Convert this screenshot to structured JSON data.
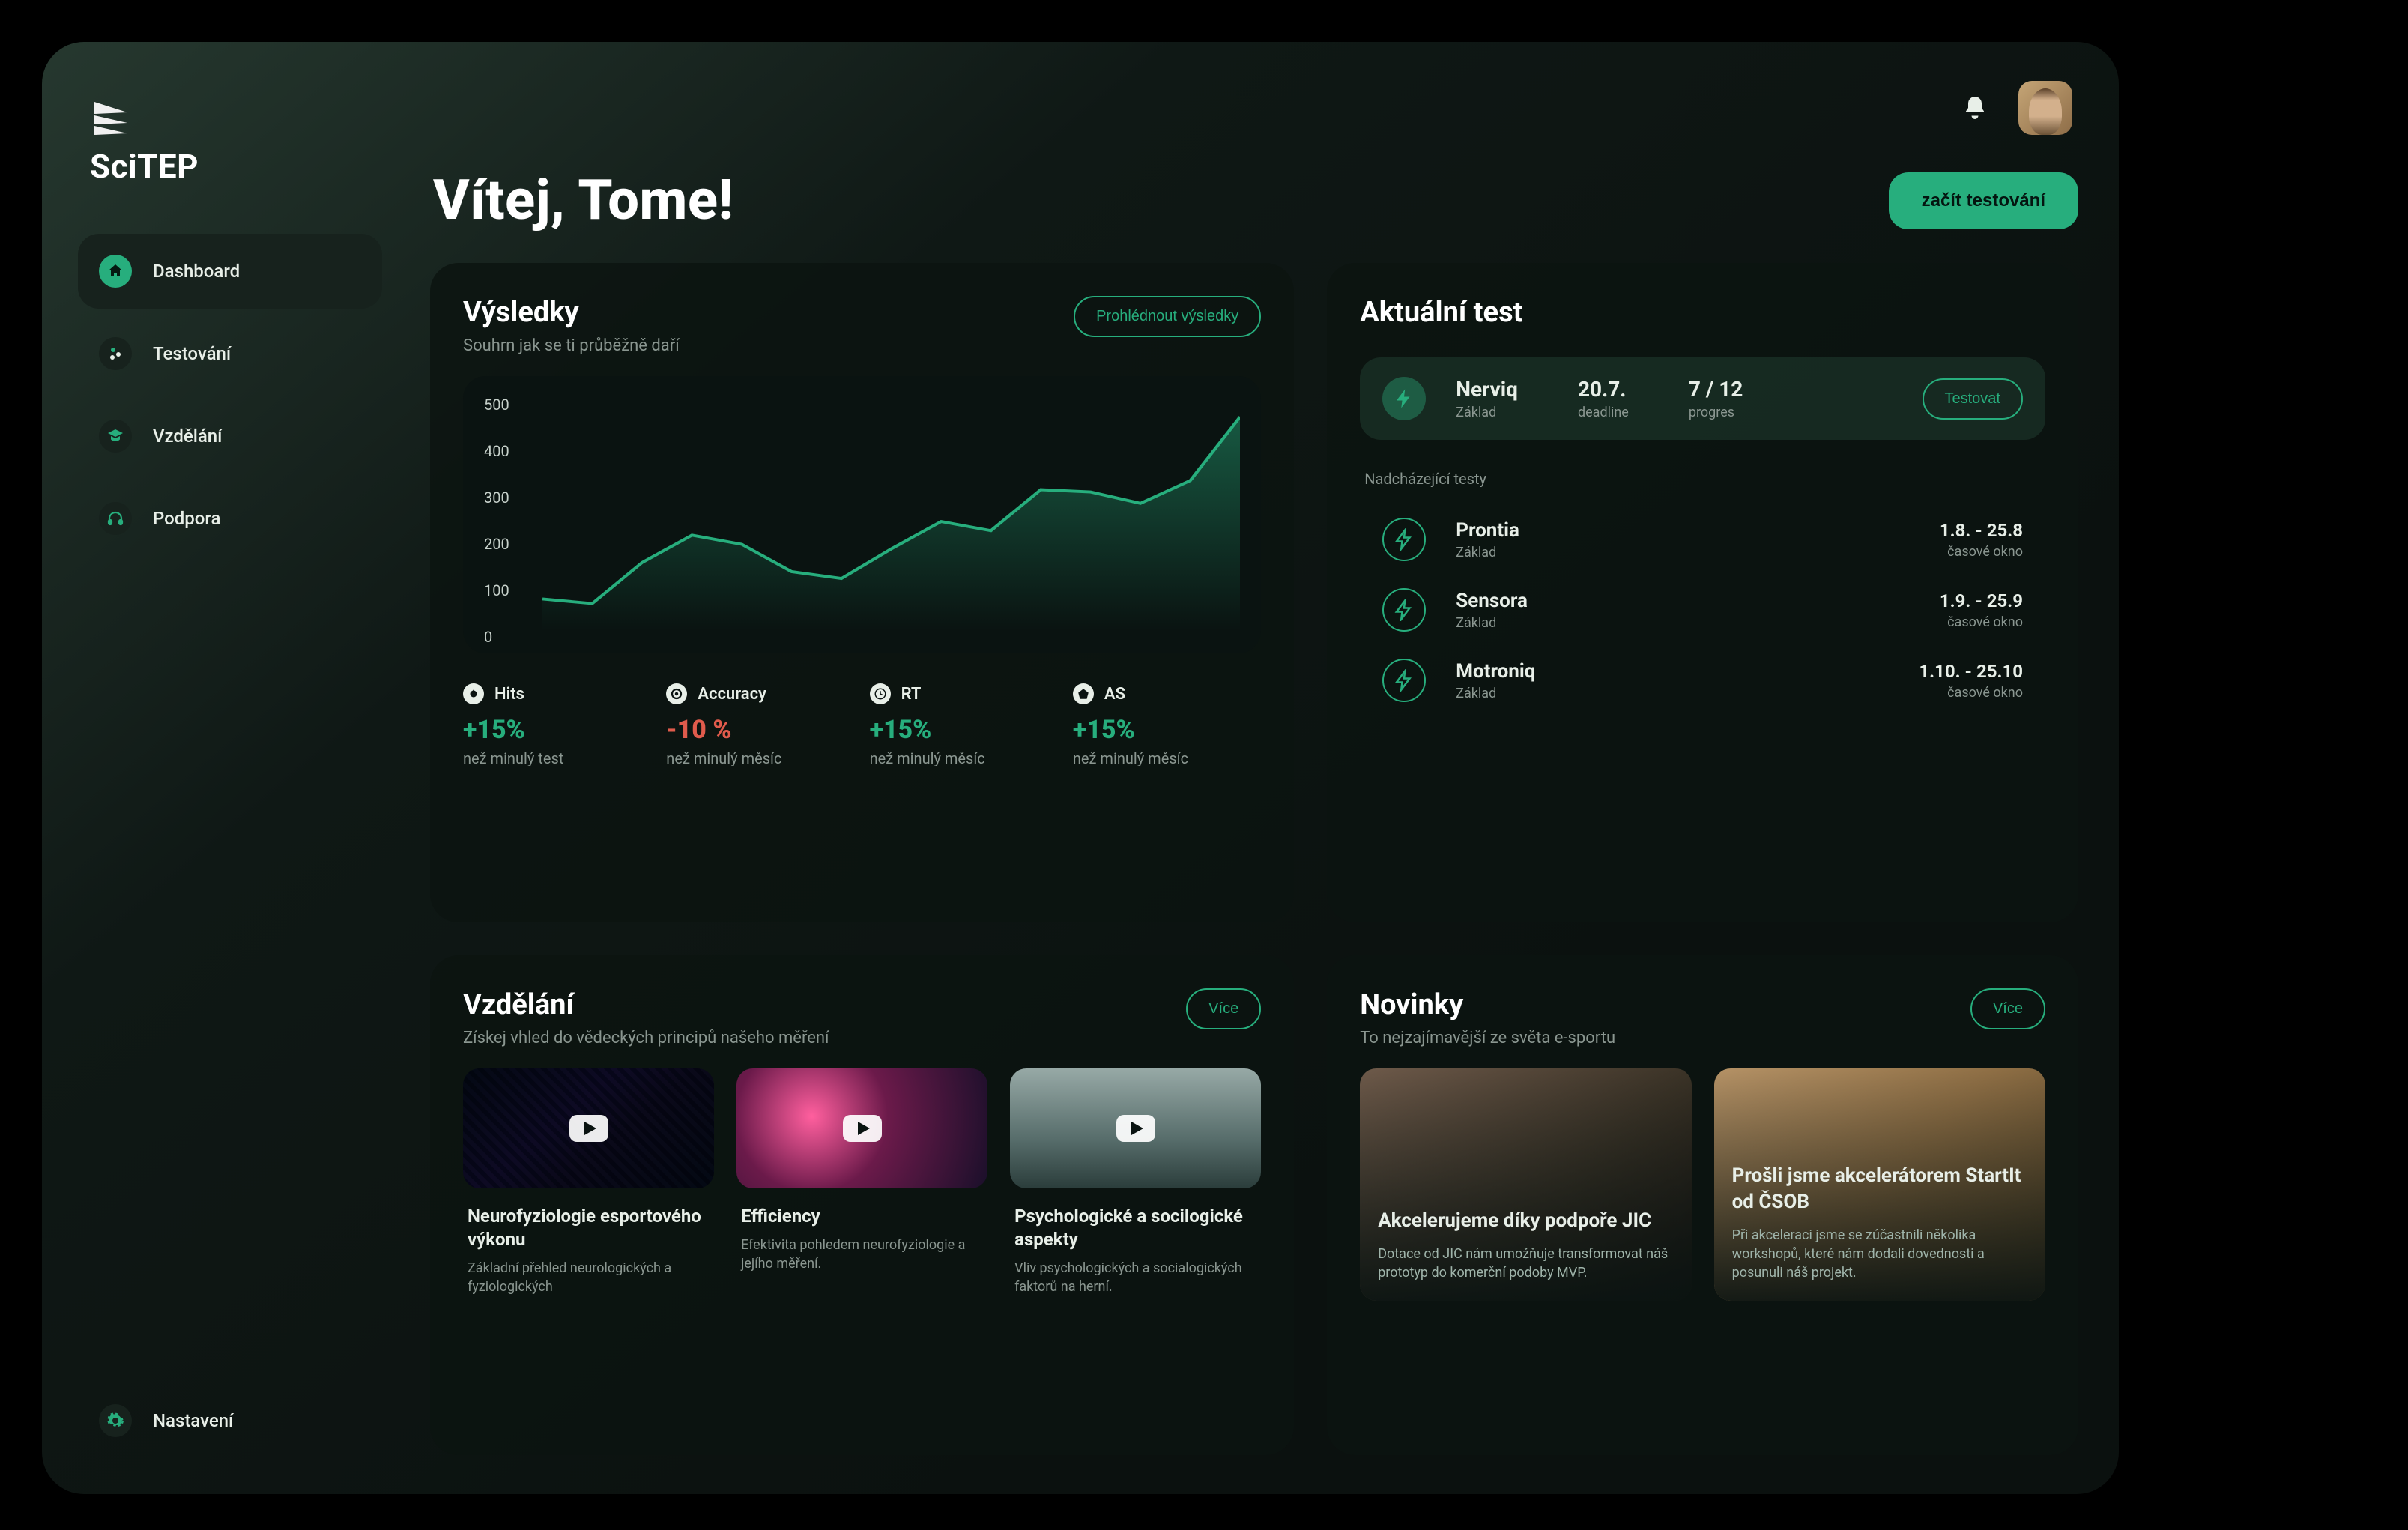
{
  "app": {
    "name": "SciTEP"
  },
  "sidebar": {
    "items": [
      {
        "label": "Dashboard"
      },
      {
        "label": "Testování"
      },
      {
        "label": "Vzdělání"
      },
      {
        "label": "Podpora"
      }
    ],
    "settings_label": "Nastavení"
  },
  "hero": {
    "greeting": "Vítej, Tome!",
    "cta": "začít testování"
  },
  "results": {
    "title": "Výsledky",
    "subtitle": "Souhrn jak se ti průběžně daří",
    "view_btn": "Prohlédnout výsledky",
    "metrics": [
      {
        "name": "Hits",
        "delta": "+15%",
        "sub": "než minulý test",
        "neg": false
      },
      {
        "name": "Accuracy",
        "delta": "-10 %",
        "sub": "než minulý měsíc",
        "neg": true
      },
      {
        "name": "RT",
        "delta": "+15%",
        "sub": "než minulý měsíc",
        "neg": false
      },
      {
        "name": "AS",
        "delta": "+15%",
        "sub": "než minulý měsíc",
        "neg": false
      }
    ]
  },
  "chart_data": {
    "type": "line",
    "title": "",
    "xlabel": "",
    "ylabel": "",
    "ylim": [
      0,
      500
    ],
    "yticks": [
      0,
      100,
      200,
      300,
      400,
      500
    ],
    "x": [
      0,
      1,
      2,
      3,
      4,
      5,
      6,
      7,
      8,
      9,
      10,
      11,
      12,
      13,
      14
    ],
    "values": [
      70,
      60,
      150,
      210,
      190,
      130,
      115,
      180,
      240,
      220,
      310,
      305,
      280,
      330,
      470
    ]
  },
  "current_test": {
    "title": "Aktuální test",
    "name": "Nerviq",
    "level": "Základ",
    "deadline_value": "20.7.",
    "deadline_label": "deadline",
    "progress_value": "7 / 12",
    "progress_label": "progres",
    "action": "Testovat",
    "upcoming_label": "Nadcházející testy",
    "upcoming": [
      {
        "name": "Prontia",
        "level": "Základ",
        "window": "1.8. - 25.8",
        "window_label": "časové okno"
      },
      {
        "name": "Sensora",
        "level": "Základ",
        "window": "1.9. - 25.9",
        "window_label": "časové okno"
      },
      {
        "name": "Motroniq",
        "level": "Základ",
        "window": "1.10. - 25.10",
        "window_label": "časové okno"
      }
    ]
  },
  "education": {
    "title": "Vzdělání",
    "subtitle": "Získej vhled do vědeckých principů našeho měření",
    "more": "Více",
    "items": [
      {
        "title": "Neurofyziologie esportového výkonu",
        "sub": "Základní přehled neurologických a fyziologických"
      },
      {
        "title": "Efficiency",
        "sub": "Efektivita pohledem neurofyziologie a jejího měření."
      },
      {
        "title": "Psychologické a socilogické aspekty",
        "sub": "Vliv psychologických  a socialogických faktorů na herní."
      }
    ]
  },
  "news": {
    "title": "Novinky",
    "subtitle": "To nejzajímavější ze světa e-sportu",
    "more": "Více",
    "items": [
      {
        "title": "Akcelerujeme díky podpoře JIC",
        "sub": "Dotace od JIC nám umožňuje transformovat náš prototyp do komerční podoby MVP."
      },
      {
        "title": "Prošli jsme akcelerátorem StartIt od ČSOB",
        "sub": "Při akceleraci jsme se zúčastnili několika workshopů, které nám dodali dovednosti a posunuli náš projekt."
      }
    ]
  },
  "colors": {
    "accent": "#27ae7d",
    "danger": "#e05b4c"
  }
}
